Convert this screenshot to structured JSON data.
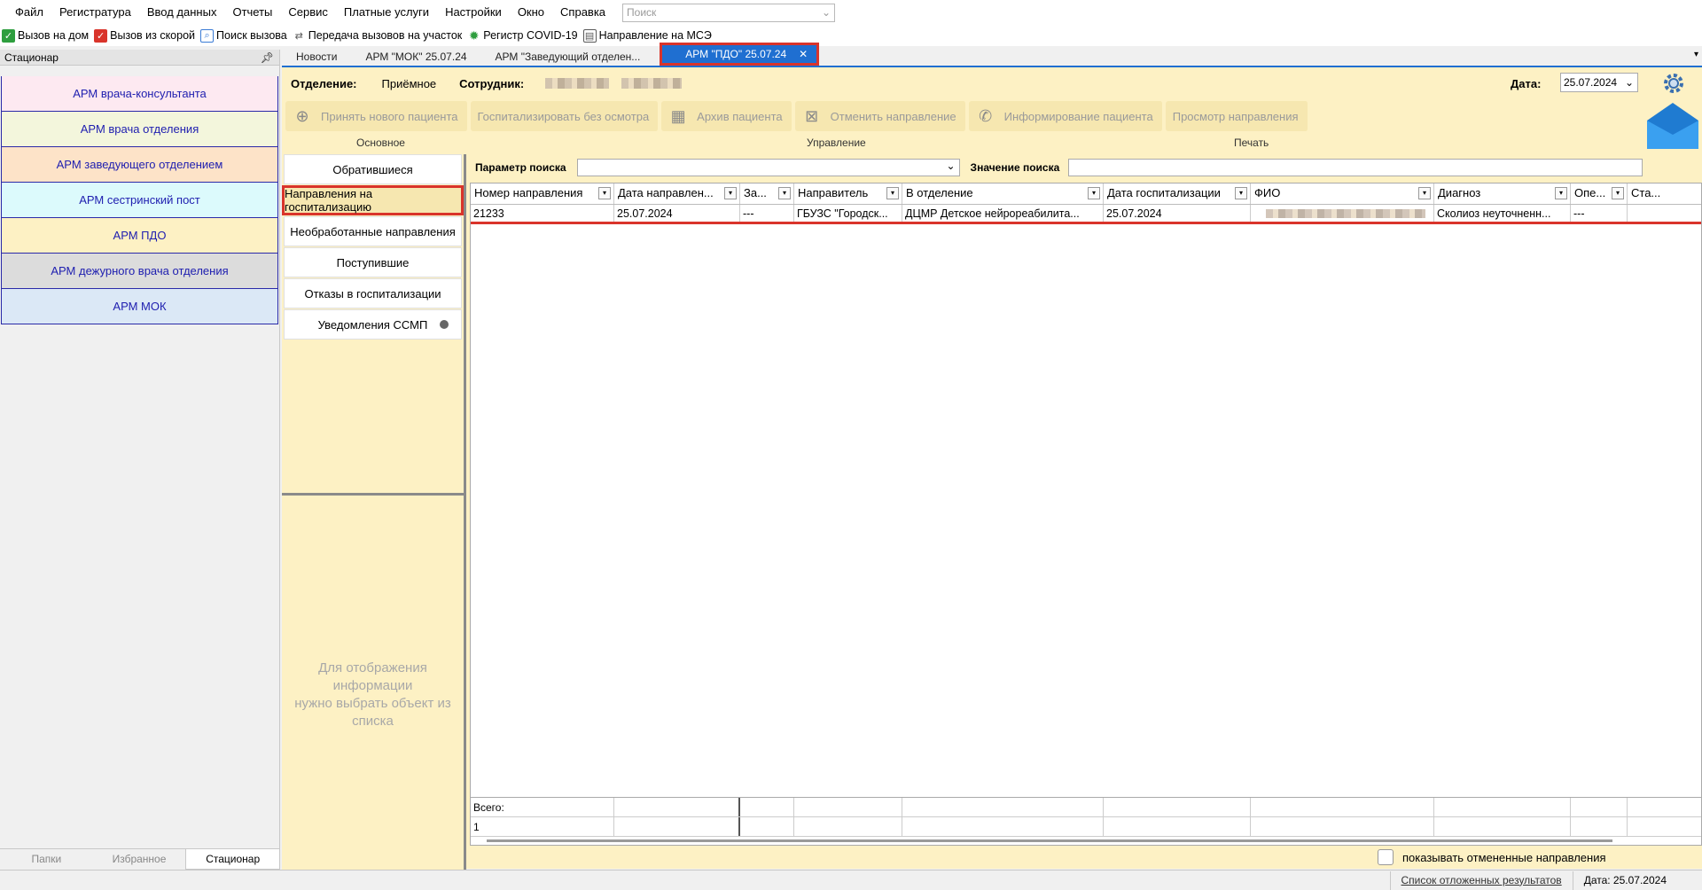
{
  "menu": {
    "items": [
      "Файл",
      "Регистратура",
      "Ввод данных",
      "Отчеты",
      "Сервис",
      "Платные услуги",
      "Настройки",
      "Окно",
      "Справка"
    ],
    "search_placeholder": "Поиск"
  },
  "toolbar": {
    "items": [
      {
        "label": "Вызов на дом",
        "icon": "check-green-icon",
        "color": "#2e9e3e"
      },
      {
        "label": "Вызов из скорой",
        "icon": "check-red-icon",
        "color": "#d9342b"
      },
      {
        "label": "Поиск вызова",
        "icon": "search-call-icon",
        "color": "#3a7bd5"
      },
      {
        "label": "Передача вызовов на участок",
        "icon": "transfer-icon",
        "color": "#5a5a5a"
      },
      {
        "label": "Регистр COVID-19",
        "icon": "virus-icon",
        "color": "#2e9e3e"
      },
      {
        "label": "Направление на МСЭ",
        "icon": "document-icon",
        "color": "#5a5a5a"
      }
    ]
  },
  "left_panel": {
    "title": "Стационар",
    "arms": [
      {
        "label": "АРМ врача-консультанта",
        "bg": "#fde9f1"
      },
      {
        "label": "АРМ врача отделения",
        "bg": "#f3f6dc"
      },
      {
        "label": "АРМ заведующего отделением",
        "bg": "#fde3c8"
      },
      {
        "label": "АРМ сестринский пост",
        "bg": "#dcfafc"
      },
      {
        "label": "АРМ ПДО",
        "bg": "#fdf1c4"
      },
      {
        "label": "АРМ дежурного врача отделения",
        "bg": "#dcdcdc"
      },
      {
        "label": "АРМ МОК",
        "bg": "#dbe8f6"
      }
    ],
    "tabs": [
      "Папки",
      "Избранное",
      "Стационар"
    ]
  },
  "doc_tabs": [
    "Новости",
    "АРМ \"МОК\" 25.07.24",
    "АРМ \"Заведующий отделен...",
    "АРМ \"ПДО\" 25.07.24"
  ],
  "info": {
    "dept_label": "Отделение:",
    "dept_value": "Приёмное",
    "employee_label": "Сотрудник:",
    "date_label": "Дата:",
    "date_value": "25.07.2024"
  },
  "ribbon": {
    "buttons": [
      {
        "label": "Принять нового пациента",
        "icon": "add-patient-icon"
      },
      {
        "label": "Госпитализировать без осмотра",
        "icon": ""
      },
      {
        "label": "Архив пациента",
        "icon": "archive-icon"
      },
      {
        "label": "Отменить направление",
        "icon": "cancel-referral-icon"
      },
      {
        "label": "Информирование пациента",
        "icon": "phone-add-icon"
      },
      {
        "label": "Просмотр направления",
        "icon": ""
      }
    ],
    "groups": [
      "Основное",
      "Управление",
      "Печать"
    ]
  },
  "sidenav": {
    "items": [
      "Обратившиеся",
      "Направления на госпитализацию",
      "Необработанные направления",
      "Поступившие",
      "Отказы в госпитализации",
      "Уведомления ССМП"
    ],
    "placeholder_line1": "Для отображения информации",
    "placeholder_line2": "нужно выбрать объект из списка"
  },
  "search": {
    "param_label": "Параметр поиска",
    "value_label": "Значение поиска"
  },
  "grid": {
    "columns": [
      "Номер направления",
      "Дата направлен...",
      "За...",
      "Направитель",
      "В отделение",
      "Дата госпитализации",
      "ФИО",
      "Диагноз",
      "Опе...",
      "Ста..."
    ],
    "rows": [
      [
        "21233",
        "25.07.2024",
        "---",
        "ГБУЗС \"Городск...",
        "ДЦМР Детское нейрореабилита...",
        "25.07.2024",
        "",
        "Сколиоз неуточненн...",
        "---",
        ""
      ]
    ],
    "total_label": "Всего:",
    "total_value": "1"
  },
  "show_cancelled_label": "показывать отмененные направления",
  "status": {
    "deferred_link": "Список отложенных результатов",
    "date_text": "Дата: 25.07.2024"
  }
}
